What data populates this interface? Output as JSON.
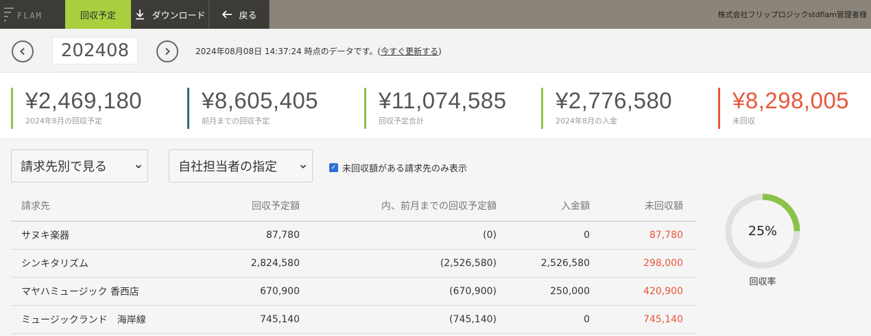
{
  "topbar": {
    "logo_text": "FLAM",
    "active_tab": "回収予定",
    "download_label": "ダウンロード",
    "back_label": "戻る",
    "user_label": "株式会社フリップロジックstdflam管理者様"
  },
  "nav": {
    "month": "202408",
    "timestamp_text": "2024年08月08日 14:37:24 時点のデータです。(",
    "refresh_link": "今すぐ更新する",
    "timestamp_close": ")"
  },
  "summary": [
    {
      "value": "¥2,469,180",
      "label": "2024年8月の回収予定",
      "color": "#8bc34a"
    },
    {
      "value": "¥8,605,405",
      "label": "前月までの回収予定",
      "color": "#2f6e6a"
    },
    {
      "value": "¥11,074,585",
      "label": "回収予定合計",
      "color": "#8bc34a"
    },
    {
      "value": "¥2,776,580",
      "label": "2024年8月の入金",
      "color": "#8bc34a"
    },
    {
      "value": "¥8,298,005",
      "label": "未回収",
      "color": "#e8563a"
    }
  ],
  "filters": {
    "view_select": "請求先別で見る",
    "staff_select": "自社担当者の指定",
    "checkbox_label": "未回収額がある請求先のみ表示",
    "checkbox_checked": true
  },
  "table": {
    "headers": [
      "請求先",
      "回収予定額",
      "内、前月までの回収予定額",
      "入金額",
      "未回収額"
    ],
    "rows": [
      [
        "サヌキ楽器",
        "87,780",
        "(0)",
        "0",
        "87,780"
      ],
      [
        "シンキタリズム",
        "2,824,580",
        "(2,526,580)",
        "2,526,580",
        "298,000"
      ],
      [
        "マヤハミュージック 香西店",
        "670,900",
        "(670,900)",
        "250,000",
        "420,900"
      ],
      [
        "ミュージックランド　海岸線",
        "745,140",
        "(745,140)",
        "0",
        "745,140"
      ]
    ]
  },
  "donut": {
    "percent_text": "25%",
    "fraction": 0.25,
    "label": "回収率",
    "fill_color": "#8bc34a",
    "track_color": "#e0e0e0"
  }
}
